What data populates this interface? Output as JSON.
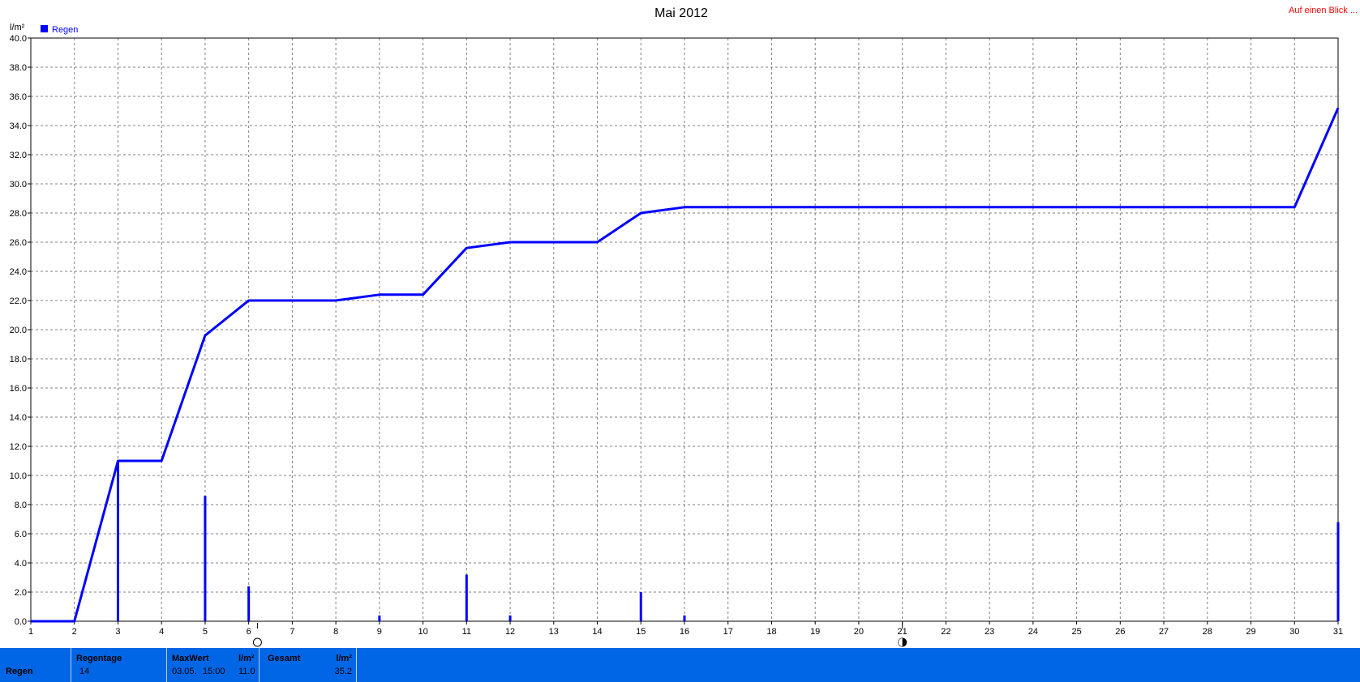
{
  "title": "Mai 2012",
  "top_link": "Auf einen Blick ...",
  "chart_data": {
    "type": "bar+line",
    "ylabel": "l/m²",
    "ylim": [
      0,
      40
    ],
    "y_ticks": [
      "0.0",
      "2.0",
      "4.0",
      "6.0",
      "8.0",
      "10.0",
      "12.0",
      "14.0",
      "16.0",
      "18.0",
      "20.0",
      "22.0",
      "24.0",
      "26.0",
      "28.0",
      "30.0",
      "32.0",
      "34.0",
      "36.0",
      "38.0",
      "40.0"
    ],
    "x_ticks": [
      "1",
      "2",
      "3",
      "4",
      "5",
      "6",
      "7",
      "8",
      "9",
      "10",
      "11",
      "12",
      "13",
      "14",
      "15",
      "16",
      "17",
      "18",
      "19",
      "20",
      "21",
      "22",
      "23",
      "24",
      "25",
      "26",
      "27",
      "28",
      "29",
      "30",
      "31"
    ],
    "legend": [
      {
        "name": "Regen",
        "color": "#0000ff"
      }
    ],
    "grid": true,
    "daily_bars": {
      "name": "Regen",
      "color": "#0000ff",
      "points": [
        [
          3,
          11.0
        ],
        [
          5,
          8.6
        ],
        [
          6,
          2.4
        ],
        [
          9,
          0.4
        ],
        [
          11,
          3.2
        ],
        [
          12,
          0.4
        ],
        [
          15,
          2.0
        ],
        [
          16,
          0.4
        ],
        [
          31,
          6.8
        ]
      ]
    },
    "cumulative_line": {
      "color": "#0000ff",
      "points": [
        [
          1,
          0
        ],
        [
          2,
          0
        ],
        [
          3,
          11.0
        ],
        [
          4,
          11.0
        ],
        [
          5,
          19.6
        ],
        [
          6,
          22.0
        ],
        [
          7,
          22.0
        ],
        [
          8,
          22.0
        ],
        [
          9,
          22.4
        ],
        [
          10,
          22.4
        ],
        [
          11,
          25.6
        ],
        [
          12,
          26.0
        ],
        [
          13,
          26.0
        ],
        [
          14,
          26.0
        ],
        [
          15,
          28.0
        ],
        [
          16,
          28.4
        ],
        [
          17,
          28.4
        ],
        [
          18,
          28.4
        ],
        [
          19,
          28.4
        ],
        [
          20,
          28.4
        ],
        [
          21,
          28.4
        ],
        [
          22,
          28.4
        ],
        [
          23,
          28.4
        ],
        [
          24,
          28.4
        ],
        [
          25,
          28.4
        ],
        [
          26,
          28.4
        ],
        [
          27,
          28.4
        ],
        [
          28,
          28.4
        ],
        [
          29,
          28.4
        ],
        [
          30,
          28.4
        ],
        [
          31,
          35.2
        ]
      ]
    },
    "moon_markers": [
      {
        "day": 6.2,
        "phase": "full-moon"
      },
      {
        "day": 21.0,
        "phase": "new-moon"
      }
    ]
  },
  "footer": {
    "row_label": "Regen",
    "regentage_label": "Regentage",
    "regentage_value": "14",
    "maxwert_label": "MaxWert",
    "maxwert_unit": "l/m²",
    "maxwert_date": "03.05.",
    "maxwert_time": "15:00",
    "maxwert_value": "11.0",
    "gesamt_label": "Gesamt",
    "gesamt_unit": "l/m²",
    "gesamt_value": "35.2"
  }
}
